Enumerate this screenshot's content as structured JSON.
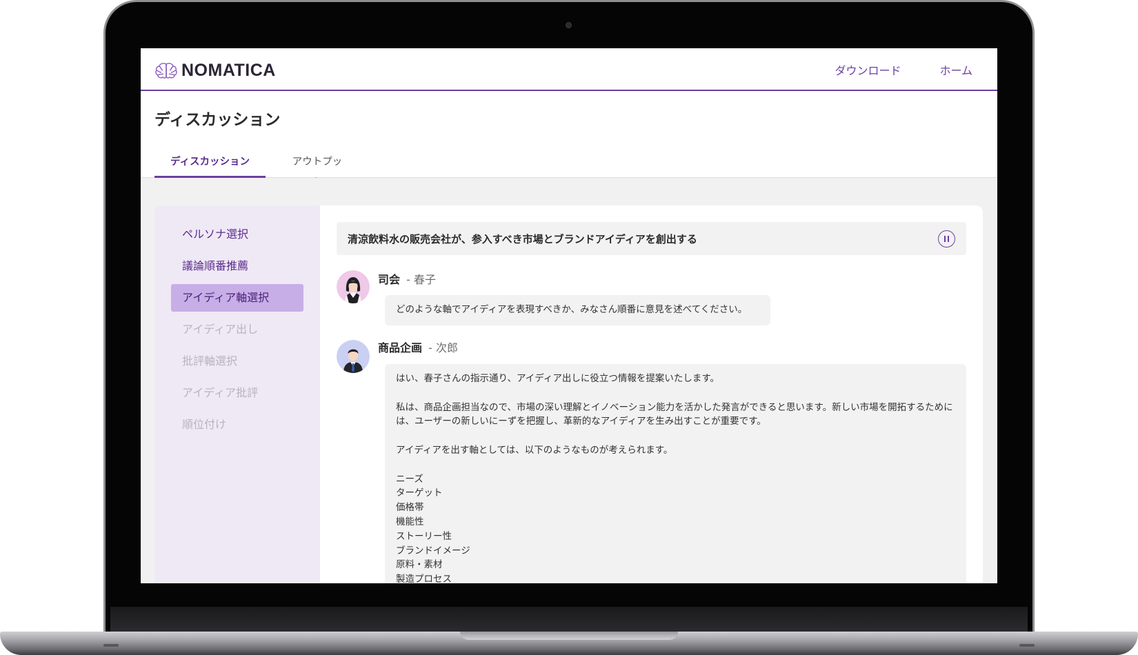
{
  "app": {
    "brand": "NOMATICA",
    "nav": [
      "ダウンロード",
      "ホーム"
    ],
    "page_title": "ディスカッション",
    "tabs": [
      "ディスカッション",
      "アウトプット"
    ]
  },
  "sidebar": {
    "items": [
      {
        "label": "ペルソナ選択",
        "state": "done"
      },
      {
        "label": "議論順番推薦",
        "state": "done"
      },
      {
        "label": "アイディア軸選択",
        "state": "active"
      },
      {
        "label": "アイディア出し",
        "state": "pending"
      },
      {
        "label": "批評軸選択",
        "state": "pending"
      },
      {
        "label": "アイディア批評",
        "state": "pending"
      },
      {
        "label": "順位付け",
        "state": "pending"
      }
    ]
  },
  "discussion": {
    "topic": "清涼飲料水の販売会社が、参入すべき市場とブランドアイディアを創出する",
    "messages": [
      {
        "role": "司会",
        "name": "- 春子",
        "avatar": "female-avatar",
        "text": "どのような軸でアイディアを表現すべきか、みなさん順番に意見を述べてください。"
      },
      {
        "role": "商品企画",
        "name": "- 次郎",
        "avatar": "male-avatar",
        "paragraphs": [
          "はい、春子さんの指示通り、アイディア出しに役立つ情報を提案いたします。",
          "私は、商品企画担当なので、市場の深い理解とイノベーション能力を活かした発言ができると思います。新しい市場を開拓するためには、ユーザーの新しいにーずを把握し、革新的なアイディアを生み出すことが重要です。",
          "アイディアを出す軸としては、以下のようなものが考えられます。"
        ],
        "list": [
          "ニーズ",
          "ターゲット",
          "価格帯",
          "機能性",
          "ストーリー性",
          "ブランドイメージ",
          "原料・素材",
          "製造プロセス"
        ]
      }
    ]
  },
  "colors": {
    "accent": "#6b3fa0",
    "sidebar_bg": "#efe9f5",
    "active_item": "#c7aee6",
    "bubble_bg": "#f2f2f2"
  }
}
